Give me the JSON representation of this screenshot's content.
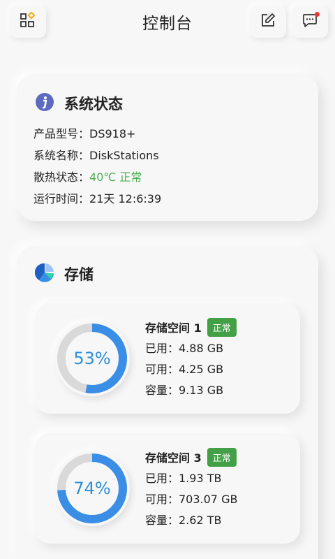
{
  "header": {
    "title": "控制台",
    "notification_dot_color": "#e53935"
  },
  "system_status": {
    "title": "系统状态",
    "rows": [
      {
        "key": "产品型号：",
        "value": "DS918+",
        "status": "normal"
      },
      {
        "key": "系统名称：",
        "value": "DiskStations",
        "status": "normal"
      },
      {
        "key": "散热状态：",
        "value": "40℃ 正常",
        "status": "ok"
      },
      {
        "key": "运行时间：",
        "value": "21天 12:6:39",
        "status": "normal"
      }
    ]
  },
  "storage": {
    "title": "存储",
    "pools": [
      {
        "name": "存储空间 1",
        "badge": "正常",
        "percent": 53,
        "percent_label": "53%",
        "used": "已用：4.88 GB",
        "available": "可用：4.25 GB",
        "capacity": "容量：9.13 GB"
      },
      {
        "name": "存储空间 3",
        "badge": "正常",
        "percent": 74,
        "percent_label": "74%",
        "used": "已用：1.93 TB",
        "available": "可用：703.07 GB",
        "capacity": "容量：2.62 TB"
      }
    ]
  },
  "colors": {
    "accent": "#3a8ee6",
    "ok": "#4caf50",
    "badge": "#43a047",
    "ring_track": "#d9d9d9"
  },
  "icons": [
    "apps-icon",
    "edit-icon",
    "chat-icon",
    "info-icon",
    "pie-chart-icon"
  ]
}
